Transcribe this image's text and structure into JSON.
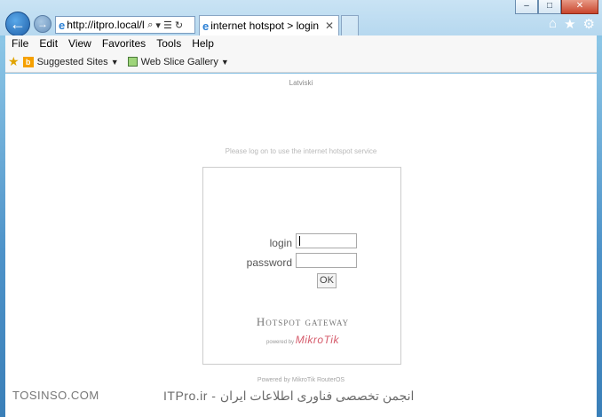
{
  "window": {
    "minimize_icon": "–",
    "maximize_icon": "□",
    "close_icon": "✕"
  },
  "nav": {
    "back_icon": "←",
    "forward_icon": "→",
    "url": "http://itpro.local/lc",
    "search_icon": "⌕",
    "dropdown_icon": "▾",
    "compat_icon": "☰",
    "refresh_icon": "↻"
  },
  "tab": {
    "title": "internet hotspot > login",
    "close_icon": "✕"
  },
  "toolbar_icons": {
    "home": "⌂",
    "favorites": "★",
    "tools": "⚙"
  },
  "menubar": {
    "items": [
      "File",
      "Edit",
      "View",
      "Favorites",
      "Tools",
      "Help"
    ]
  },
  "favbar": {
    "suggested_sites": "Suggested Sites",
    "web_slice_gallery": "Web Slice Gallery"
  },
  "page": {
    "language_link": "Latviski",
    "notice": "Please log on to use the internet hotspot service",
    "login_label": "login",
    "password_label": "password",
    "login_value": "",
    "password_value": "",
    "ok_label": "OK",
    "gateway_title": "Hotspot gateway",
    "powered_by_prefix": "powered by",
    "powered_by_brand": "MikroTik",
    "footer": "Powered by MikroTik RouterOS"
  },
  "watermark": {
    "left": "TOSINSO.COM",
    "right": "ITPro.ir - انجمن تخصصی فناوری اطلاعات ایران"
  },
  "colors": {
    "accent_blue": "#1f5fa8",
    "mikrotik_red": "#d55a6a",
    "close_red": "#c8452c"
  }
}
